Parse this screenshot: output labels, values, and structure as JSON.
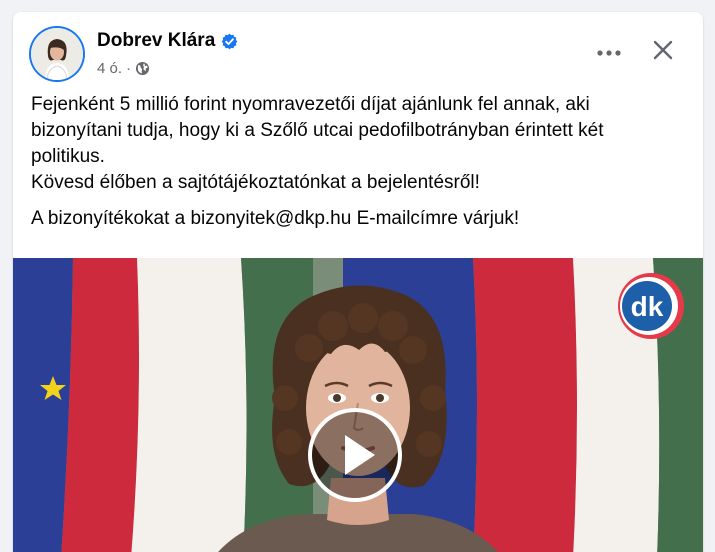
{
  "post": {
    "author_name": "Dobrev Klára",
    "verified_icon": "verified-badge-icon",
    "timestamp": "4 ó.",
    "separator": "·",
    "audience_icon": "globe-icon",
    "more_icon": "more-options-icon",
    "close_icon": "close-icon",
    "text_paragraph_1_line_1": "Fejenként 5 millió forint nyomravezetői díjat ajánlunk fel annak, aki",
    "text_paragraph_1_line_2": "bizonyítani tudja, hogy ki a Szőlő utcai pedofilbotrányban érintett két",
    "text_paragraph_1_line_3": "politikus.",
    "text_paragraph_1_line_4": "Kövesd élőben a sajtótájékoztatónkat a bejelentésről!",
    "text_paragraph_2": "A bizonyítékokat a bizonyitek@dkp.hu E-mailcímre várjuk!",
    "video": {
      "logo_text": "dk",
      "play_icon": "play-icon"
    }
  },
  "colors": {
    "page_bg": "#f0f2f5",
    "card_bg": "#ffffff",
    "text": "#050505",
    "secondary_text": "#65676b",
    "verified_blue": "#1877f2",
    "flag_red": "#cd2a3e",
    "flag_green": "#436f4d",
    "eu_blue": "#2b3f97",
    "dk_blue": "#1d5fa8"
  }
}
